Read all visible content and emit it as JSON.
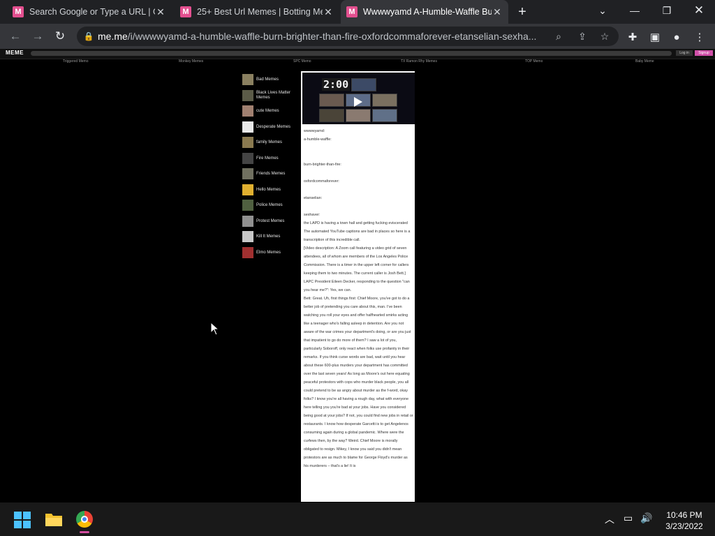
{
  "browser": {
    "tabs": [
      {
        "title": "Search Google or Type a URL | Gr",
        "active": false
      },
      {
        "title": "25+ Best Url Memes | Botting Me",
        "active": false
      },
      {
        "title": "Wwwwyamd A-Humble-Waffle Bu",
        "active": true
      }
    ],
    "new_tab_icon": "+",
    "url_host": "me.me",
    "url_path": "/i/wwwwyamd-a-humble-waffle-burn-brighter-than-fire-oxfordcommaforever-etanselian-sexha..."
  },
  "site": {
    "logo": "MEME",
    "login_label": "Log in",
    "signup_label": "Signup",
    "categories": [
      "Triggered Memo",
      "Monkey Memes",
      "SPC Memo",
      "TX Ramon Rhy Memes",
      "TOP Memo",
      "Baby Meme"
    ]
  },
  "sidebar": {
    "items": [
      {
        "label": "Bad Memes",
        "color": "#8a8060"
      },
      {
        "label": "Black Lives Matter Memes",
        "color": "#5b5b48"
      },
      {
        "label": "cute Memes",
        "color": "#a08070"
      },
      {
        "label": "Desperate Memes",
        "color": "#e8e8e8"
      },
      {
        "label": "family Memes",
        "color": "#8a7a50"
      },
      {
        "label": "Fire Memes",
        "color": "#444444"
      },
      {
        "label": "Friends Memes",
        "color": "#707060"
      },
      {
        "label": "Hello Memes",
        "color": "#e0b030"
      },
      {
        "label": "Police Memes",
        "color": "#506040"
      },
      {
        "label": "Protest Memes",
        "color": "#909090"
      },
      {
        "label": "Kill It Memes",
        "color": "#c8c8c8"
      },
      {
        "label": "Elmo Memes",
        "color": "#a03030"
      }
    ]
  },
  "post": {
    "video_timer": "2:00",
    "tags": [
      "wwwwyamd:",
      "a-humble-waffle:",
      "burn-brighter-than-fire:",
      "oxfordcommaforever:",
      "etanselian:",
      "sexhaver:"
    ],
    "paragraphs": [
      "the LAPD is having a town hall and getting fucking eviscerated",
      "The automated YouTube captions are bad in places so here is a transcription of this incredible call.",
      "[Video description: A Zoom call featuring a video grid of seven attendees, all of whom are members of the Los Angeles Police Commission. There is a timer in the upper left corner for callers keeping them to two minutes. The current caller is Josh Bett.]",
      "LAPC President Eileen Decker, responding to the question \"can you hear me?\": Yes, we can.",
      "Bett: Great. Uh, first things first: Chief Moore, you've got to do a better job of pretending you care about this, man. I've been watching you roll your eyes and offer halfhearted smirks acting like a teenager who's falling asleep in detention. Are you not aware of the war crimes your department's doing, or are you just that impatient to go do more of them? I saw a lot of you, particularly Soboroff, only react when folks use profanity in their remarks. If you think curse words are bad, wait until you hear about these 600-plus murders your department has committed over the last seven years! As long as Moore's out here equating peaceful protestors with cops who murder black people, you all could pretend to be as angry about murder as the f-word, okay folks? I know you're all having a rough day, what with everyone here telling you you're bad at your jobs. Have you considered being good at your jobs? If not, you could find new jobs in retail or restaurants. I know how desperate Garcetti is to get Angelenos consuming again during a global pandemic. Where were the curfews then, by the way? Weird. Chief Moore is morally obligated to resign. Mikey, I know you said you didn't mean protestors are as much to blame for George Floyd's murder as his murderers – that's a lie! It is"
    ]
  },
  "taskbar": {
    "time": "10:46 PM",
    "date": "3/23/2022"
  }
}
